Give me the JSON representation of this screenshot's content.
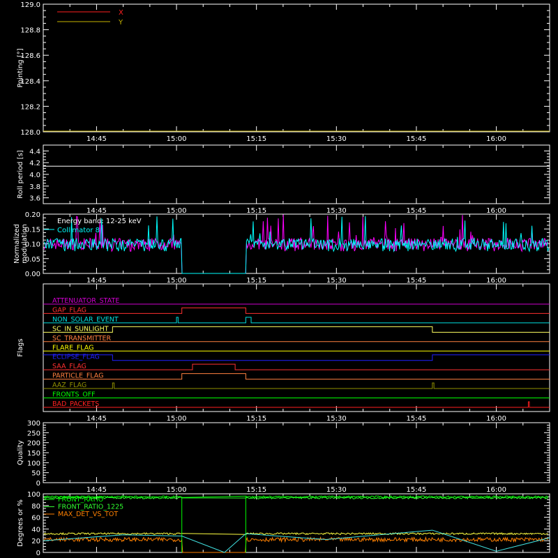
{
  "chart_data": [
    {
      "type": "line",
      "ylabel": "Pointing [°]",
      "ylim": [
        128.0,
        129.0
      ],
      "yticks": [
        "128.0",
        "128.2",
        "128.4",
        "128.6",
        "128.8",
        "129.0"
      ],
      "xticks": [
        "14:45",
        "15:00",
        "15:15",
        "15:30",
        "15:45",
        "16:00"
      ],
      "legend_position": "top-left",
      "series": [
        {
          "name": "X",
          "color": "#ff2020",
          "x": [],
          "y": []
        },
        {
          "name": "Y",
          "color": "#c8b400",
          "x": [
            "14:35",
            "16:10"
          ],
          "y": [
            128.0,
            128.0
          ]
        }
      ]
    },
    {
      "type": "line",
      "ylabel": "Roll period [s]",
      "ylim": [
        3.5,
        4.5
      ],
      "yticks": [
        "3.6",
        "3.8",
        "4.0",
        "4.2",
        "4.4"
      ],
      "xticks": [
        "14:45",
        "15:00",
        "15:15",
        "15:30",
        "15:45",
        "16:00"
      ],
      "series": [
        {
          "color": "#ffffff",
          "x": [
            "14:35",
            "16:10"
          ],
          "y": [
            4.14,
            4.14
          ]
        }
      ]
    },
    {
      "type": "line",
      "ylabel": "Normalized modulation",
      "ylim": [
        0.0,
        0.2
      ],
      "yticks": [
        "0.00",
        "0.05",
        "0.10",
        "0.15",
        "0.20"
      ],
      "xticks": [
        "14:45",
        "15:00",
        "15:15",
        "15:30",
        "15:45",
        "16:00"
      ],
      "annotations": [
        "Energy band: 12-25 keV"
      ],
      "legend_position": "top-left",
      "gap": [
        "15:01",
        "15:13"
      ],
      "typical_range": [
        0.08,
        0.15
      ],
      "series": [
        {
          "name": "Collimator 8",
          "color": "#00ffff"
        },
        {
          "color": "#ff00ff"
        }
      ]
    },
    {
      "type": "line",
      "ylabel": "Flags",
      "xticks": [
        "14:45",
        "15:00",
        "15:15",
        "15:30",
        "15:45",
        "16:00"
      ],
      "series": [
        {
          "name": "ATTENUATOR_STATE",
          "color": "#d000d0",
          "x": [
            "14:35",
            "16:10"
          ],
          "y": [
            0,
            0
          ]
        },
        {
          "name": "GAP_FLAG",
          "color": "#ff3030",
          "x": [
            "14:35",
            "15:01",
            "15:01",
            "15:13",
            "15:13",
            "16:10"
          ],
          "y": [
            0,
            0,
            1,
            1,
            0,
            0
          ]
        },
        {
          "name": "NON_SOLAR_EVENT",
          "color": "#00e0e0",
          "x": [
            "14:35",
            "15:00",
            "15:00",
            "15:00.3",
            "15:00.3",
            "15:13",
            "15:13",
            "15:14",
            "15:14",
            "16:10"
          ],
          "y": [
            0,
            0,
            1,
            1,
            0,
            0,
            1,
            1,
            0,
            0
          ]
        },
        {
          "name": "SC_IN_SUNLIGHT",
          "color": "#ffff60",
          "x": [
            "14:35",
            "14:48",
            "14:48",
            "15:48",
            "15:48",
            "16:10"
          ],
          "y": [
            0,
            0,
            1,
            1,
            0,
            0
          ]
        },
        {
          "name": "SC_TRANSMITTER",
          "color": "#ff8040",
          "x": [
            "14:35",
            "16:10"
          ],
          "y": [
            0,
            0
          ]
        },
        {
          "name": "FLARE_FLAG",
          "color": "#ffff00",
          "x": [
            "14:35",
            "16:10"
          ],
          "y": [
            0,
            0
          ]
        },
        {
          "name": "ECLIPSE_FLAG",
          "color": "#2020ff",
          "x": [
            "14:35",
            "14:48",
            "14:48",
            "15:48",
            "15:48",
            "16:10"
          ],
          "y": [
            1,
            1,
            0,
            0,
            1,
            1
          ]
        },
        {
          "name": "SAA_FLAG",
          "color": "#ff3030",
          "x": [
            "14:35",
            "15:03",
            "15:03",
            "15:11",
            "15:11",
            "16:10"
          ],
          "y": [
            0,
            0,
            1,
            1,
            0,
            0
          ]
        },
        {
          "name": "PARTICLE_FLAG",
          "color": "#ff8040",
          "x": [
            "14:35",
            "15:01",
            "15:01",
            "15:13",
            "15:13",
            "16:10"
          ],
          "y": [
            0,
            0,
            1,
            1,
            0,
            0
          ]
        },
        {
          "name": "AAZ_FLAG",
          "color": "#909000",
          "x": [
            "14:35",
            "14:48",
            "14:48",
            "14:48.3",
            "14:48.3",
            "15:48",
            "15:48",
            "15:48.3",
            "15:48.3",
            "16:10"
          ],
          "y": [
            0,
            0,
            1,
            1,
            0,
            0,
            1,
            1,
            0,
            0
          ]
        },
        {
          "name": "FRONTS_OFF",
          "color": "#00ff00",
          "x": [
            "14:35",
            "16:10"
          ],
          "y": [
            0,
            0
          ]
        },
        {
          "name": "BAD_PACKETS",
          "color": "#ff2020",
          "x": [
            "14:35",
            "16:06",
            "16:06",
            "16:06.2",
            "16:06.2",
            "16:10"
          ],
          "y": [
            0,
            0,
            1,
            1,
            0,
            0
          ]
        }
      ]
    },
    {
      "type": "line",
      "ylabel": "Quality",
      "ylim": [
        0,
        300
      ],
      "yticks": [
        "0",
        "50",
        "100",
        "150",
        "200",
        "250",
        "300"
      ],
      "xticks": [
        "14:45",
        "15:00",
        "15:15",
        "15:30",
        "15:45",
        "16:00"
      ],
      "series": [
        {
          "color": "#ffffff",
          "x": [
            "14:35",
            "16:10"
          ],
          "y": [
            0,
            0
          ]
        }
      ]
    },
    {
      "type": "line",
      "ylabel": "Degrees or %",
      "ylim": [
        0,
        100
      ],
      "yticks": [
        "0",
        "20",
        "40",
        "60",
        "80",
        "100"
      ],
      "legend_position": "top-left",
      "gap": [
        "15:01",
        "15:13"
      ],
      "series": [
        {
          "name": "FRONT_RATIO",
          "color": "#00ff00",
          "approx_level": 95
        },
        {
          "name": "FRONT_RATIO_1225",
          "color": "#30ff30",
          "approx_level": 93
        },
        {
          "name": "MAX_DET_VS_TOT",
          "color": "#ff8000",
          "approx_level": 22
        },
        {
          "color": "#ffff40",
          "approx_level": 32
        },
        {
          "color": "#40e0e0",
          "x": [
            "14:35",
            "14:50",
            "15:01",
            "15:09",
            "15:13",
            "15:28",
            "15:48",
            "16:00",
            "16:10"
          ],
          "y": [
            20,
            30,
            28,
            0,
            32,
            22,
            38,
            2,
            25
          ]
        }
      ]
    }
  ]
}
